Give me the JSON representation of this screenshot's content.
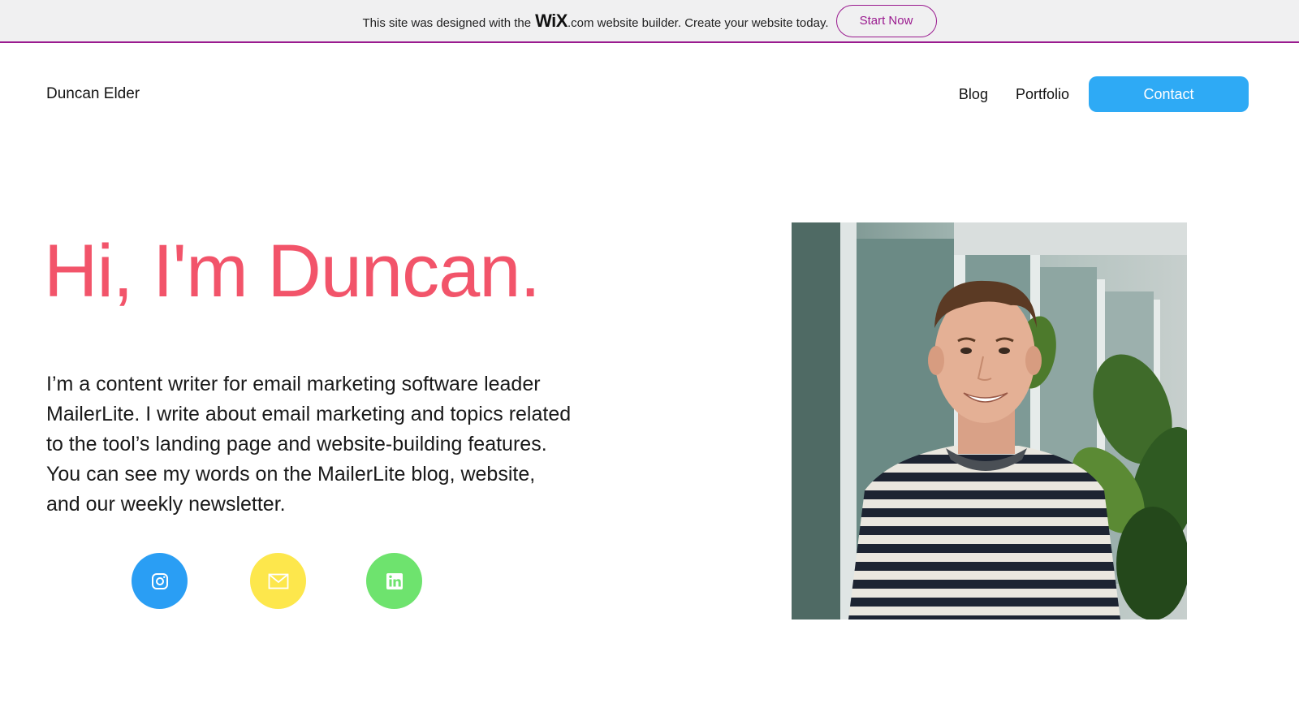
{
  "banner": {
    "text_before": "This site was designed with the",
    "wix_logo": "WiX",
    "text_after": ".com website builder. Create your website today.",
    "cta_label": "Start Now"
  },
  "header": {
    "site_name": "Duncan Elder",
    "nav": [
      {
        "label": "Blog"
      },
      {
        "label": "Portfolio"
      }
    ],
    "contact_label": "Contact"
  },
  "hero": {
    "title": "Hi, I'm Duncan.",
    "bio": "I’m a content writer for email marketing software leader MailerLite. I write about email marketing and topics related to the tool’s landing page and website-building features. You can see my words on the MailerLite blog, website, and our weekly newsletter."
  },
  "social": [
    {
      "icon": "instagram-icon",
      "color": "#2a9ef4"
    },
    {
      "icon": "mail-icon",
      "color": "#fde74c"
    },
    {
      "icon": "linkedin-icon",
      "color": "#6ee36e"
    }
  ],
  "colors": {
    "accent_pink": "#f2546a",
    "contact_blue": "#2eaaf5",
    "wix_purple": "#9a1a8f"
  }
}
